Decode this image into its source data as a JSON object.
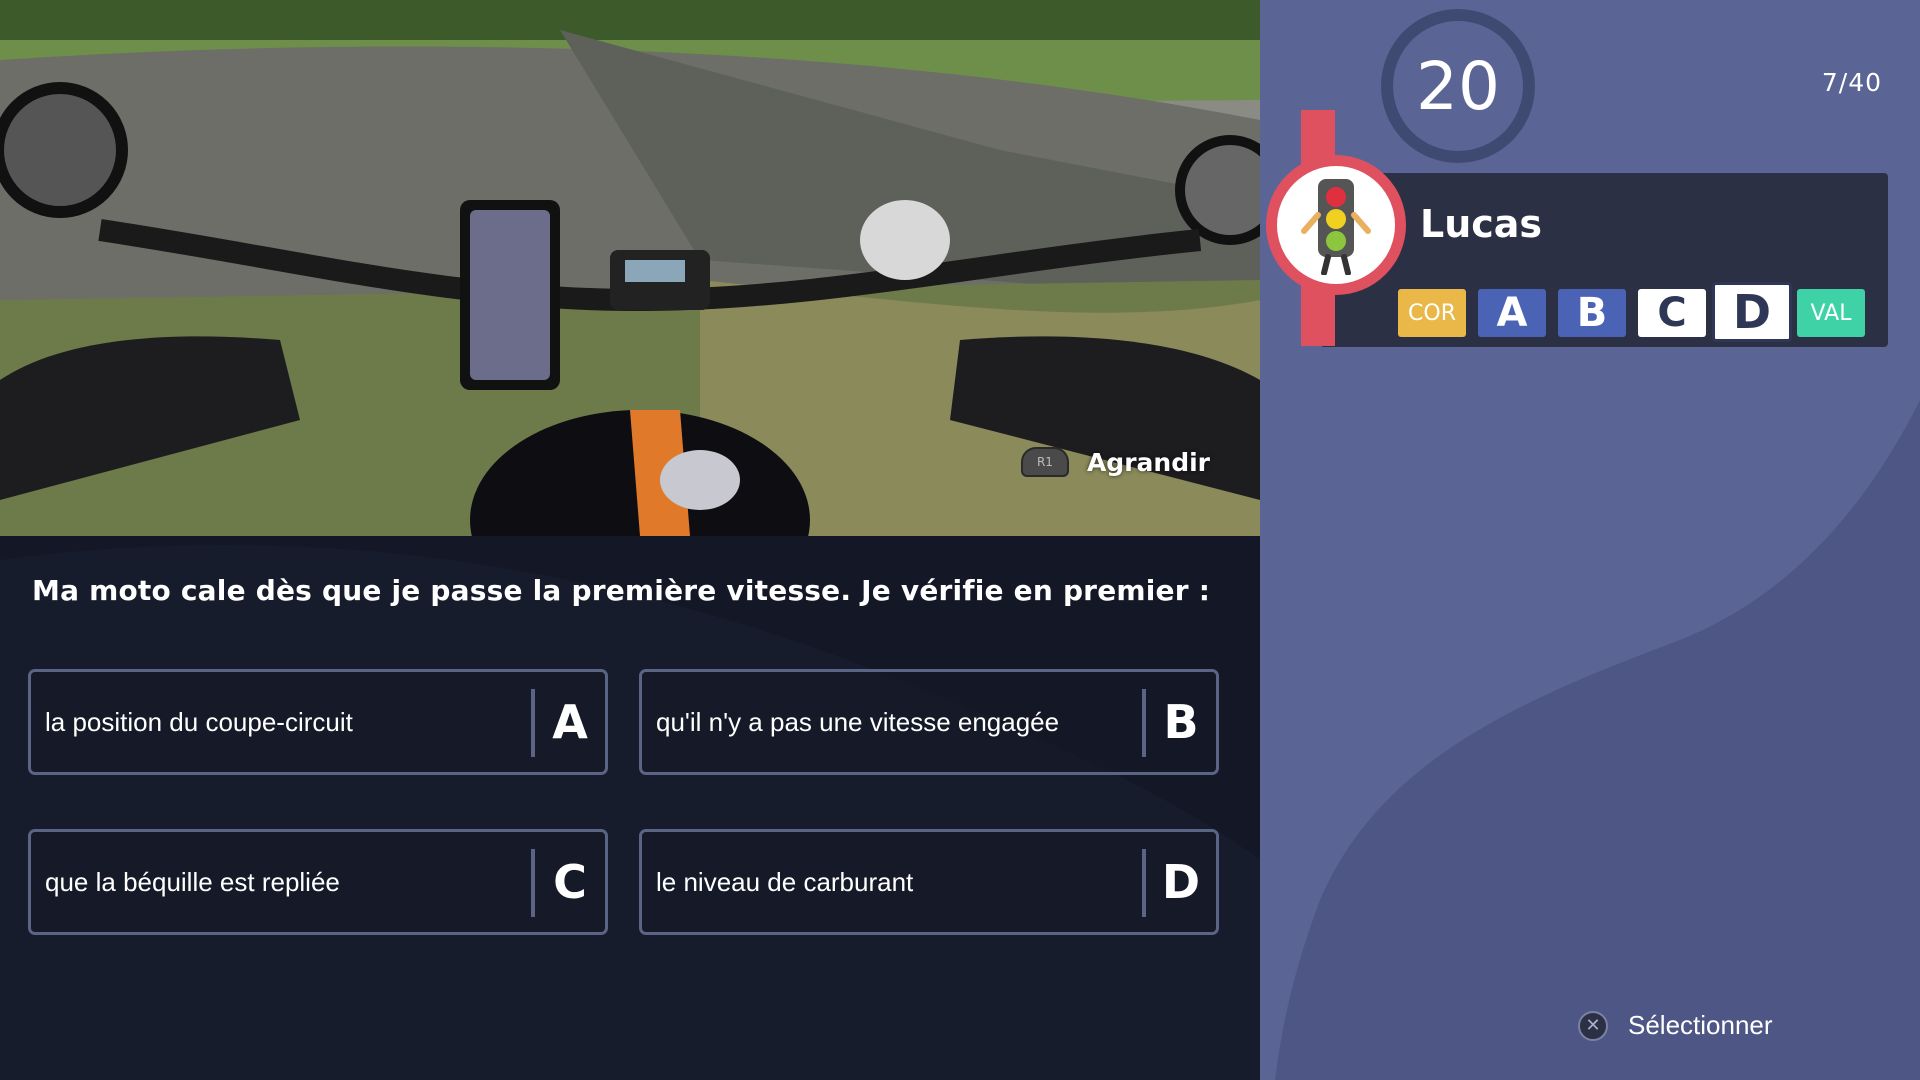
{
  "photo": {
    "enlarge_button_icon": "R1",
    "enlarge_label": "Agrandir"
  },
  "question": {
    "text": "Ma moto cale dès que je passe la première vitesse. Je vérifie en premier :"
  },
  "answers": [
    {
      "letter": "A",
      "text": "la position du coupe-circuit"
    },
    {
      "letter": "B",
      "text": "qu'il n'y a pas une vitesse engagée"
    },
    {
      "letter": "C",
      "text": "que la béquille est repliée"
    },
    {
      "letter": "D",
      "text": "le niveau de carburant"
    }
  ],
  "sidebar": {
    "timer_value": "20",
    "question_counter": "7/40",
    "player": {
      "name": "Lucas",
      "avatar_icon": "traffic-light-icon"
    },
    "keys": {
      "correct": "COR",
      "a": "A",
      "b": "B",
      "c": "C",
      "d": "D",
      "validate": "VAL",
      "selected": "D"
    },
    "hint": {
      "icon": "cross-button-icon",
      "label": "Sélectionner"
    }
  },
  "colors": {
    "panel": "#5b6595",
    "dark_bg": "#141826",
    "card": "#2b3045",
    "accent_red": "#e05160",
    "cor_yellow": "#e9b848",
    "key_blue": "#4a63b4",
    "val_green": "#3fd2a6"
  }
}
